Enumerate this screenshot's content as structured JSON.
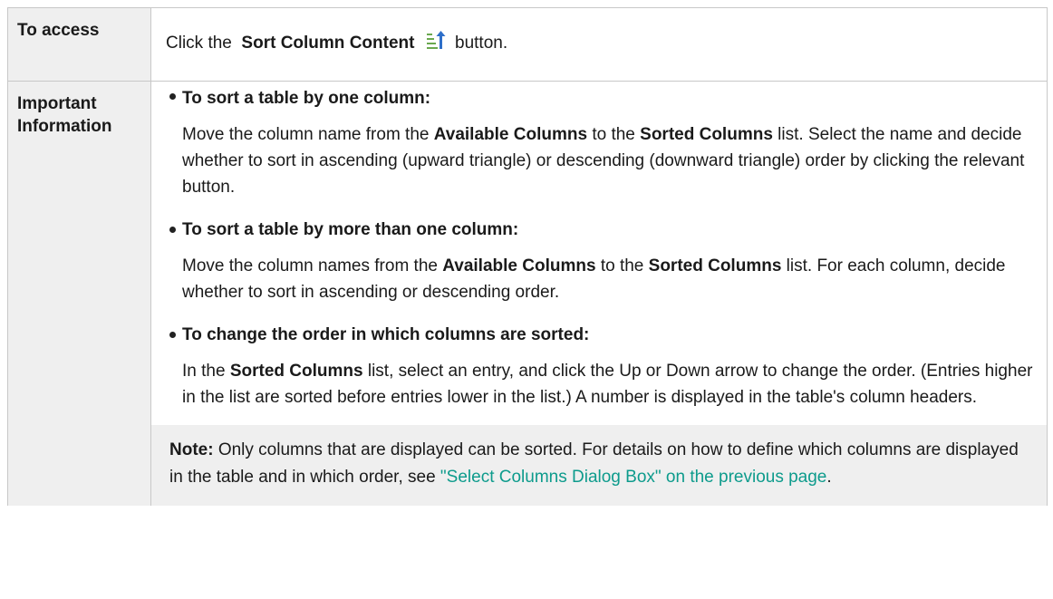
{
  "rows": {
    "access": {
      "label": "To access",
      "text_pre": "Click the",
      "button_name": "Sort Column Content",
      "text_post": "button.",
      "icon": "sort-column-content-icon"
    },
    "important": {
      "label_line1": "Important",
      "label_line2": "Information",
      "items": [
        {
          "title": "To sort a table by one column:",
          "body": [
            {
              "t": "Move the column name from the "
            },
            {
              "b": "Available Columns"
            },
            {
              "t": " to the "
            },
            {
              "b": "Sorted Columns"
            },
            {
              "t": " list. Select the name and decide whether to sort in ascending (upward triangle) or descending (downward triangle) order by clicking the relevant button."
            }
          ]
        },
        {
          "title": "To sort a table by more than one column:",
          "body": [
            {
              "t": "Move the column names from the "
            },
            {
              "b": "Available Columns"
            },
            {
              "t": " to the "
            },
            {
              "b": "Sorted Columns"
            },
            {
              "t": " list. For each column, decide whether to sort in ascending or descending order."
            }
          ]
        },
        {
          "title": "To change the order in which columns are sorted:",
          "body": [
            {
              "t": "In the "
            },
            {
              "b": "Sorted Columns"
            },
            {
              "t": " list, select an entry, and click the Up or Down arrow to change the order. (Entries higher in the list are sorted before entries lower in the list.) A number is displayed in the table's column headers."
            }
          ]
        }
      ],
      "note": {
        "label": "Note:",
        "text": " Only columns that are displayed can be sorted. For details on how to define which columns are displayed in the table and in which order, see ",
        "link_text": "\"Select Columns Dialog Box\" on the previous page",
        "end": "."
      }
    }
  },
  "colors": {
    "link": "#0d9b8c",
    "label_bg": "#efefef",
    "border": "#c8c8c8"
  }
}
